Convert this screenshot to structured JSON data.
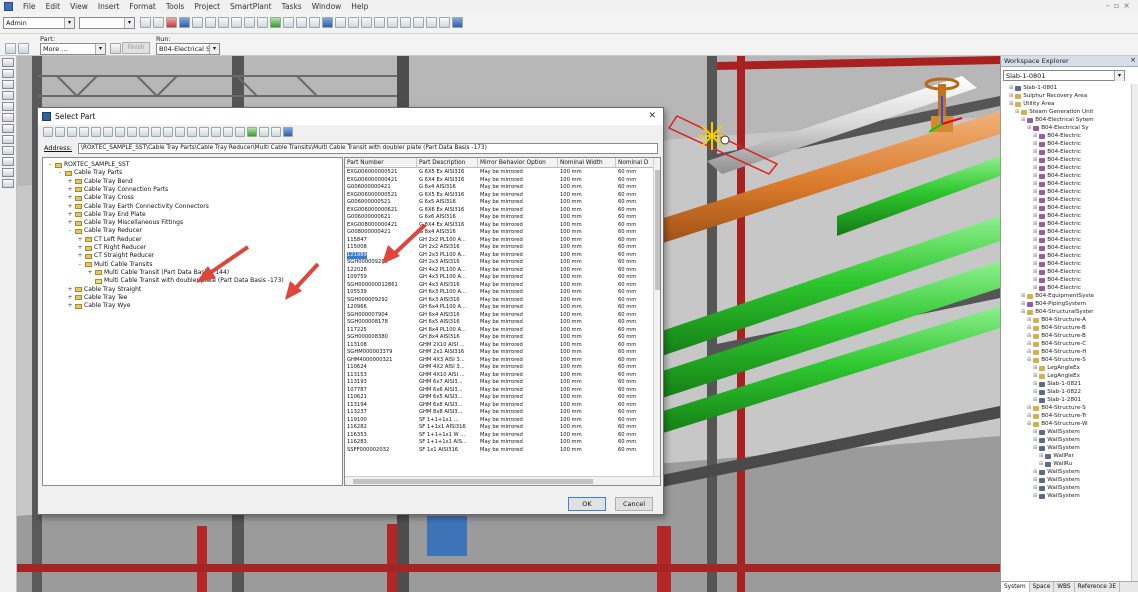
{
  "menu": [
    "File",
    "Edit",
    "View",
    "Insert",
    "Format",
    "Tools",
    "Project",
    "SmartPlant",
    "Tasks",
    "Window",
    "Help"
  ],
  "toolbar": {
    "role_value": "Admin",
    "part_label": "Part:",
    "part_value": "More ...",
    "finish_label": "Finish",
    "run_label": "Run:",
    "run_value": "B04-Electrical Syt"
  },
  "explorer": {
    "title": "Workspace Explorer",
    "selected": "Slab-1-0801",
    "items": [
      {
        "text": "Slab-1-0801",
        "indent": 1,
        "icon": "slab"
      },
      {
        "text": "Sulphur Recovery Area",
        "indent": 1,
        "icon": "fold"
      },
      {
        "text": "Utility Area",
        "indent": 1,
        "icon": "fold"
      },
      {
        "text": "Steam Generation Unit",
        "indent": 2,
        "icon": "fold"
      },
      {
        "text": "B04-Electrical Sytem",
        "indent": 3,
        "icon": "pipe"
      },
      {
        "text": "B04-Electrical Sy",
        "indent": 4,
        "icon": "pipe"
      },
      {
        "text": "B04-Electric",
        "indent": 5,
        "icon": "pipe"
      },
      {
        "text": "B04-Electric",
        "indent": 5,
        "icon": "pipe"
      },
      {
        "text": "B04-Electric",
        "indent": 5,
        "icon": "pipe"
      },
      {
        "text": "B04-Electric",
        "indent": 5,
        "icon": "pipe"
      },
      {
        "text": "B04-Electric",
        "indent": 5,
        "icon": "pipe"
      },
      {
        "text": "B04-Electric",
        "indent": 5,
        "icon": "pipe"
      },
      {
        "text": "B04-Electric",
        "indent": 5,
        "icon": "pipe"
      },
      {
        "text": "B04-Electric",
        "indent": 5,
        "icon": "pipe"
      },
      {
        "text": "B04-Electric",
        "indent": 5,
        "icon": "pipe"
      },
      {
        "text": "B04-Electric",
        "indent": 5,
        "icon": "pipe"
      },
      {
        "text": "B04-Electric",
        "indent": 5,
        "icon": "pipe"
      },
      {
        "text": "B04-Electric",
        "indent": 5,
        "icon": "pipe"
      },
      {
        "text": "B04-Electric",
        "indent": 5,
        "icon": "pipe"
      },
      {
        "text": "B04-Electric",
        "indent": 5,
        "icon": "pipe"
      },
      {
        "text": "B04-Electric",
        "indent": 5,
        "icon": "pipe"
      },
      {
        "text": "B04-Electric",
        "indent": 5,
        "icon": "pipe"
      },
      {
        "text": "B04-Electric",
        "indent": 5,
        "icon": "pipe"
      },
      {
        "text": "B04-Electric",
        "indent": 5,
        "icon": "pipe"
      },
      {
        "text": "B04-Electric",
        "indent": 5,
        "icon": "pipe"
      },
      {
        "text": "B04-Electric",
        "indent": 5,
        "icon": "pipe"
      },
      {
        "text": "B04-EquipmentSyste",
        "indent": 3,
        "icon": "fold"
      },
      {
        "text": "B04-PipingSystem",
        "indent": 3,
        "icon": "pipe"
      },
      {
        "text": "B04-StructuralSyster",
        "indent": 3,
        "icon": "fold"
      },
      {
        "text": "B04-Structure-A",
        "indent": 4,
        "icon": "fold"
      },
      {
        "text": "B04-Structure-B",
        "indent": 4,
        "icon": "fold"
      },
      {
        "text": "B04-Structure-B",
        "indent": 4,
        "icon": "fold"
      },
      {
        "text": "B04-Structure-C",
        "indent": 4,
        "icon": "fold"
      },
      {
        "text": "B04-Structure-H",
        "indent": 4,
        "icon": "fold"
      },
      {
        "text": "B04-Structure-S",
        "indent": 4,
        "icon": "fold"
      },
      {
        "text": "LegAngleEx",
        "indent": 5,
        "icon": "fold"
      },
      {
        "text": "LegAngleEx",
        "indent": 5,
        "icon": "fold"
      },
      {
        "text": "Slab-1-0821",
        "indent": 5,
        "icon": "slab"
      },
      {
        "text": "Slab-1-0822",
        "indent": 5,
        "icon": "slab"
      },
      {
        "text": "Slab-1-2801",
        "indent": 5,
        "icon": "slab"
      },
      {
        "text": "B04-Structure-S",
        "indent": 4,
        "icon": "fold"
      },
      {
        "text": "B04-Structure-Tr",
        "indent": 4,
        "icon": "fold"
      },
      {
        "text": "B04-Structure-W",
        "indent": 4,
        "icon": "fold"
      },
      {
        "text": "WallSystem",
        "indent": 5,
        "icon": "slab"
      },
      {
        "text": "WallSystem",
        "indent": 5,
        "icon": "slab"
      },
      {
        "text": "WallSystem",
        "indent": 5,
        "icon": "slab"
      },
      {
        "text": "WallPar",
        "indent": 6,
        "icon": "slab"
      },
      {
        "text": "WallRu",
        "indent": 6,
        "icon": "slab"
      },
      {
        "text": "WallSystem",
        "indent": 5,
        "icon": "slab"
      },
      {
        "text": "WallSystem",
        "indent": 5,
        "icon": "slab"
      },
      {
        "text": "WallSystem",
        "indent": 5,
        "icon": "slab"
      },
      {
        "text": "WallSystem",
        "indent": 5,
        "icon": "slab"
      }
    ],
    "tabs": [
      "System",
      "Space",
      "WBS",
      "Reference 3E"
    ]
  },
  "dialog": {
    "title": "Select Part",
    "address_label": "Address:",
    "address": "\\ROXTEC_SAMPLE_SST\\Cable Tray Parts\\Cable Tray Reducer\\Multi Cable Transits\\Multi Cable Transit with doubler plate (Part Data Basis -173)",
    "tree": [
      {
        "text": "ROXTEC_SAMPLE_SST",
        "indent": 0,
        "exp": "-"
      },
      {
        "text": "Cable Tray Parts",
        "indent": 1,
        "exp": "-"
      },
      {
        "text": "Cable Tray Bend",
        "indent": 2,
        "exp": "+"
      },
      {
        "text": "Cable Tray Connection Parts",
        "indent": 2,
        "exp": "+"
      },
      {
        "text": "Cable Tray Cross",
        "indent": 2,
        "exp": "+"
      },
      {
        "text": "Cable Tray Earth Connectivity Connectors",
        "indent": 2,
        "exp": "+"
      },
      {
        "text": "Cable Tray End Plate",
        "indent": 2,
        "exp": "+"
      },
      {
        "text": "Cable Tray Miscellaneous Fittings",
        "indent": 2,
        "exp": "+"
      },
      {
        "text": "Cable Tray Reducer",
        "indent": 2,
        "exp": "-"
      },
      {
        "text": "CT Left Reducer",
        "indent": 3,
        "exp": "+"
      },
      {
        "text": "CT Right Reducer",
        "indent": 3,
        "exp": "+"
      },
      {
        "text": "CT Straight Reducer",
        "indent": 3,
        "exp": "+"
      },
      {
        "text": "Multi Cable Transits",
        "indent": 3,
        "exp": "-"
      },
      {
        "text": "Multi Cable Transit (Part Data Basis - 144)",
        "indent": 4,
        "exp": "+"
      },
      {
        "text": "Multi Cable Transit with doubler plate (Part Data Basis -173)",
        "indent": 4,
        "exp": "",
        "open": true
      },
      {
        "text": "Cable Tray Straight",
        "indent": 2,
        "exp": "+"
      },
      {
        "text": "Cable Tray Tee",
        "indent": 2,
        "exp": "+"
      },
      {
        "text": "Cable Tray Wye",
        "indent": 2,
        "exp": "+"
      }
    ],
    "columns": [
      "Part Number",
      "Part Description",
      "Mirror Behavior Option",
      "Nominal Width",
      "Nominal D"
    ],
    "rows": [
      [
        "EXG006000000521",
        "G 6X5 Ex AISI316",
        "May be mirrored",
        "100 mm",
        "60 mm"
      ],
      [
        "EXG006000000421",
        "G 6X4 Ex AISI316",
        "May be mirrored",
        "100 mm",
        "60 mm"
      ],
      [
        "G006000000421",
        "G 6x4 AISI316",
        "May be mirrored",
        "100 mm",
        "60 mm"
      ],
      [
        "EXG006000000521",
        "G 6X5 Ex AISI316",
        "May be mirrored",
        "100 mm",
        "60 mm"
      ],
      [
        "G006000000521",
        "G 6x5 AISI316",
        "May be mirrored",
        "100 mm",
        "60 mm"
      ],
      [
        "EXG006000000621",
        "G 6X6 Ex AISI316",
        "May be mirrored",
        "100 mm",
        "60 mm"
      ],
      [
        "G006000000621",
        "G 6x6 AISI316",
        "May be mirrored",
        "100 mm",
        "60 mm"
      ],
      [
        "EXG008000000421",
        "G 8X4 Ex AISI316",
        "May be mirrored",
        "100 mm",
        "60 mm"
      ],
      [
        "G008000000421",
        "G 8x4 AISI316",
        "May be mirrored",
        "100 mm",
        "60 mm"
      ],
      [
        "115847",
        "GH 2x2 PL100 A...",
        "May be mirrored",
        "100 mm",
        "60 mm"
      ],
      [
        "115008",
        "GH 2x2 AISI316",
        "May be mirrored",
        "100 mm",
        "60 mm"
      ],
      [
        "121989",
        "GH 2x3 PL100 A...",
        "May be mirrored",
        "100 mm",
        "60 mm"
      ],
      [
        "SGH000009290",
        "GH 2x3 AISI316",
        "May be mirrored",
        "100 mm",
        "60 mm"
      ],
      [
        "122028",
        "GH 4x2 PL100 A...",
        "May be mirrored",
        "100 mm",
        "60 mm"
      ],
      [
        "109759",
        "GH 4x3 PL100 A...",
        "May be mirrored",
        "100 mm",
        "60 mm"
      ],
      [
        "SGH000000012861",
        "GH 4x3 AISI316",
        "May be mirrored",
        "100 mm",
        "60 mm"
      ],
      [
        "105539",
        "GH 6x3 PL100 A...",
        "May be mirrored",
        "100 mm",
        "60 mm"
      ],
      [
        "SGH000009292",
        "GH 6x3 AISI316",
        "May be mirrored",
        "100 mm",
        "60 mm"
      ],
      [
        "120966",
        "GH 6x4 PL100 A...",
        "May be mirrored",
        "100 mm",
        "60 mm"
      ],
      [
        "SGH000007904",
        "GH 6x4 AISI316",
        "May be mirrored",
        "100 mm",
        "60 mm"
      ],
      [
        "SGH000008178",
        "GH 6x5 AISI316",
        "May be mirrored",
        "100 mm",
        "60 mm"
      ],
      [
        "117225",
        "GH 8x4 PL100 A...",
        "May be mirrored",
        "100 mm",
        "60 mm"
      ],
      [
        "SGH000008380",
        "GH 8x4 AISI316",
        "May be mirrored",
        "100 mm",
        "60 mm"
      ],
      [
        "113108",
        "GHM 2X10 AISI ...",
        "May be mirrored",
        "100 mm",
        "60 mm"
      ],
      [
        "SGHM000003379",
        "GHM 2x1 AISI316",
        "May be mirrored",
        "100 mm",
        "60 mm"
      ],
      [
        "GHM4000000321",
        "GHM 4X3 AISI 3...",
        "May be mirrored",
        "100 mm",
        "60 mm"
      ],
      [
        "110624",
        "GHM 4X2 AISI 3...",
        "May be mirrored",
        "100 mm",
        "60 mm"
      ],
      [
        "113153",
        "GHM 4X10 AISI ...",
        "May be mirrored",
        "100 mm",
        "60 mm"
      ],
      [
        "113193",
        "GHM 6x7 AISI3...",
        "May be mirrored",
        "100 mm",
        "60 mm"
      ],
      [
        "107787",
        "GHM 6x6 AISI3...",
        "May be mirrored",
        "100 mm",
        "60 mm"
      ],
      [
        "110621",
        "GHM 6x5 AISI3...",
        "May be mirrored",
        "100 mm",
        "60 mm"
      ],
      [
        "113194",
        "GHM 6x8 AISI3...",
        "May be mirrored",
        "100 mm",
        "60 mm"
      ],
      [
        "113237",
        "GHM 8x8 AISI3...",
        "May be mirrored",
        "100 mm",
        "60 mm"
      ],
      [
        "119100",
        "SF 1+1+1x1 ...",
        "May be mirrored",
        "100 mm",
        "60 mm"
      ],
      [
        "116282",
        "SF 1+1x1 AISI316",
        "May be mirrored",
        "100 mm",
        "60 mm"
      ],
      [
        "116353",
        "SF 1+1+1x1 W ...",
        "May be mirrored",
        "100 mm",
        "60 mm"
      ],
      [
        "116283",
        "SF 1+1+1x1 AIS...",
        "May be mirrored",
        "100 mm",
        "60 mm"
      ],
      [
        "SSFF000002032",
        "SF 1x1 AISI316",
        "May be mirrored",
        "100 mm",
        "60 mm"
      ]
    ],
    "selected_row": 11,
    "ok_label": "OK",
    "cancel_label": "Cancel"
  },
  "colors": {
    "arrow": "#e0453b",
    "pipe_green": "#2ec72e",
    "pipe_orange": "#d97a2a",
    "beam_red": "#b52626",
    "selection_blue": "#3879d9"
  }
}
